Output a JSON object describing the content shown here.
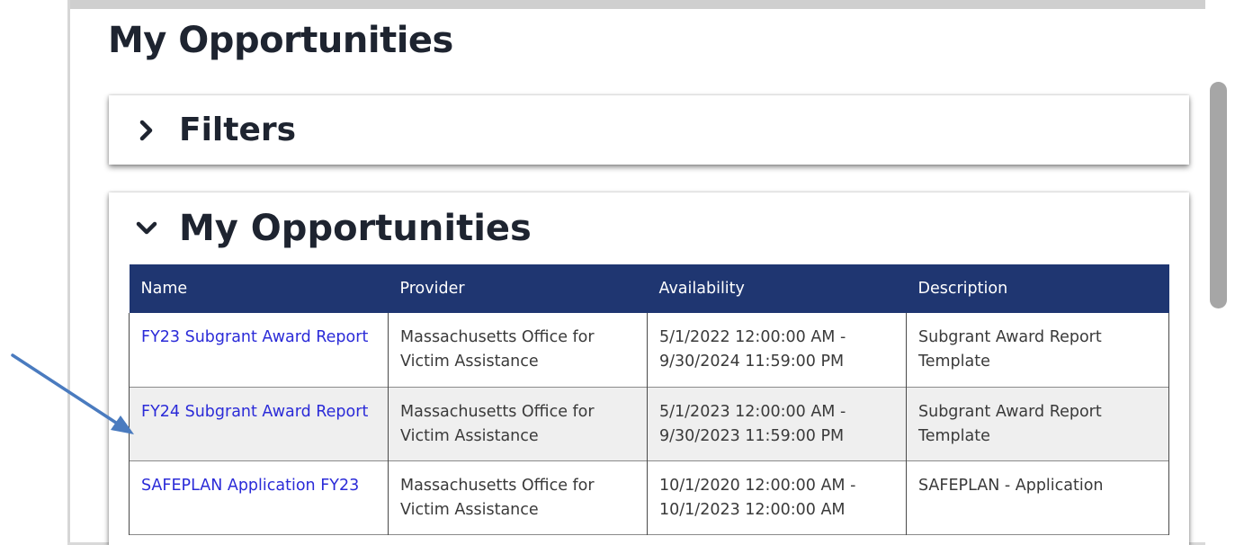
{
  "page_title": "My Opportunities",
  "filters_panel": {
    "title": "Filters",
    "icon": "chevron-right-icon"
  },
  "opportunities_panel": {
    "title": "My Opportunities",
    "icon": "chevron-down-icon",
    "columns": [
      "Name",
      "Provider",
      "Availability",
      "Description"
    ],
    "rows": [
      {
        "name": "FY23 Subgrant Award Report",
        "provider": "Massachusetts Office for Victim Assistance",
        "availability": "5/1/2022 12:00:00 AM - 9/30/2024 11:59:00 PM",
        "description": "Subgrant Award Report Template"
      },
      {
        "name": "FY24 Subgrant Award Report",
        "provider": "Massachusetts Office for Victim Assistance",
        "availability": "5/1/2023 12:00:00 AM - 9/30/2023 11:59:00 PM",
        "description": "Subgrant Award Report Template"
      },
      {
        "name": "SAFEPLAN Application FY23",
        "provider": "Massachusetts Office for Victim Assistance",
        "availability": "10/1/2020 12:00:00 AM - 10/1/2023 12:00:00 AM",
        "description": "SAFEPLAN - Application"
      }
    ]
  },
  "colors": {
    "header_bg": "#1f3671",
    "link": "#2b2bd8",
    "annotation_arrow": "#4a7bbf"
  }
}
